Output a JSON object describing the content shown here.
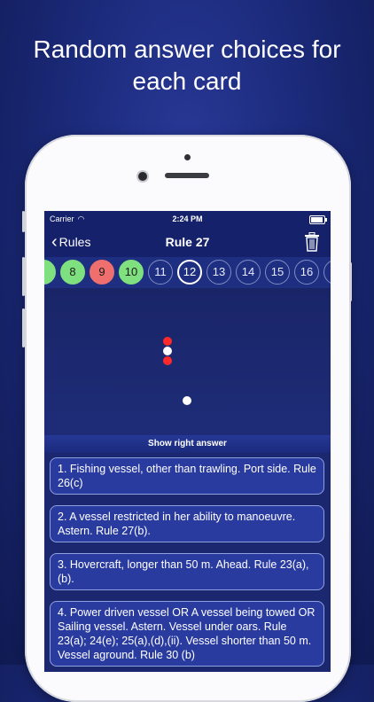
{
  "headline": [
    "Random answer choices for",
    "each card"
  ],
  "status": {
    "carrier": "Carrier",
    "time": "2:24 PM"
  },
  "nav": {
    "back_label": "Rules",
    "title": "Rule 27"
  },
  "card_chips": [
    {
      "label": "",
      "state": "green"
    },
    {
      "label": "8",
      "state": "green"
    },
    {
      "label": "9",
      "state": "red"
    },
    {
      "label": "10",
      "state": "green"
    },
    {
      "label": "11",
      "state": "default"
    },
    {
      "label": "12",
      "state": "current"
    },
    {
      "label": "13",
      "state": "default"
    },
    {
      "label": "14",
      "state": "default"
    },
    {
      "label": "15",
      "state": "default"
    },
    {
      "label": "16",
      "state": "default"
    },
    {
      "label": "",
      "state": "default"
    }
  ],
  "scene_lights": [
    "red",
    "white",
    "red",
    "white"
  ],
  "show_answer_label": "Show right answer",
  "answers": [
    "1. Fishing vessel, other than trawling. Port side. Rule 26(c)",
    "2. A vessel restricted in her ability to manoeuvre. Astern. Rule 27(b).",
    "3. Hovercraft, longer than 50 m. Ahead. Rule 23(a),(b).",
    "4. Power driven vessel OR  A vessel being towed OR Sailing vessel. Astern. Vessel under oars. Rule 23(a); 24(e); 25(a),(d),(ii). Vessel shorter than 50 m. Vessel aground. Rule 30 (b)"
  ],
  "colors": {
    "green": "#7ee07e",
    "red": "#ef6e6e",
    "light_red": "#ff2a2a",
    "light_white": "#ffffff"
  }
}
